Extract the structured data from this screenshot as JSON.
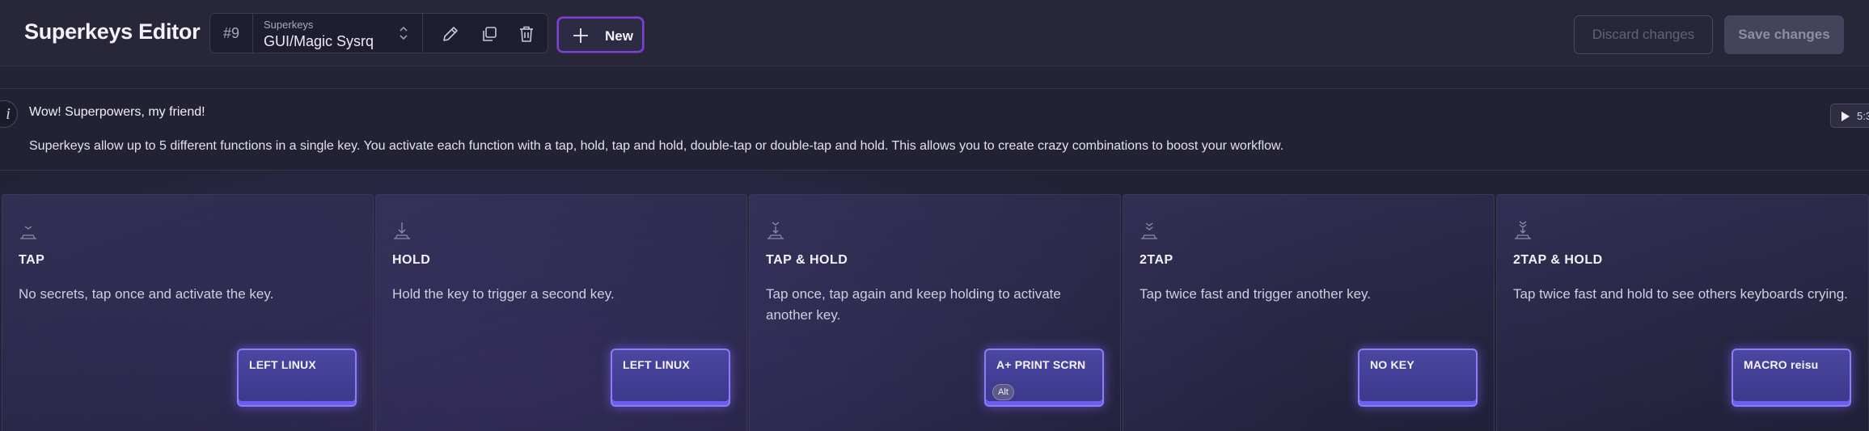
{
  "header": {
    "app_title": "Superkeys Editor",
    "selector": {
      "number": "#9",
      "caption": "Superkeys",
      "value": "GUI/Magic Sysrq"
    },
    "new_button": "New",
    "discard_button": "Discard changes",
    "save_button": "Save changes"
  },
  "banner": {
    "info_glyph": "i",
    "title": "Wow! Superpowers, my friend!",
    "text": "Superkeys allow up to 5 different functions in a single key. You activate each function with a tap, hold, tap and hold, double-tap or double-tap and hold. This allows you to create crazy combinations to boost your workflow.",
    "video_time": "5:3"
  },
  "cards": [
    {
      "title": "TAP",
      "description": "No secrets, tap once and activate the key.",
      "key": "LEFT LINUX",
      "modifier": "",
      "icon": "tap-icon"
    },
    {
      "title": "HOLD",
      "description": "Hold the key to trigger a second key.",
      "key": "LEFT LINUX",
      "modifier": "",
      "icon": "hold-icon"
    },
    {
      "title": "TAP & HOLD",
      "description": "Tap once, tap again and keep holding to activate another key.",
      "key": "A+ PRINT SCRN",
      "modifier": "Alt",
      "icon": "tap-hold-icon"
    },
    {
      "title": "2TAP",
      "description": "Tap twice fast and trigger another key.",
      "key": "NO KEY",
      "modifier": "",
      "icon": "double-tap-icon"
    },
    {
      "title": "2TAP & HOLD",
      "description": "Tap twice fast and hold to see others keyboards crying.",
      "key": "MACRO reisu",
      "modifier": "",
      "icon": "double-tap-hold-icon"
    }
  ],
  "colors": {
    "accent": "#7c3fe0",
    "key_border": "#8d7cf8",
    "background": "#1e1d33"
  }
}
